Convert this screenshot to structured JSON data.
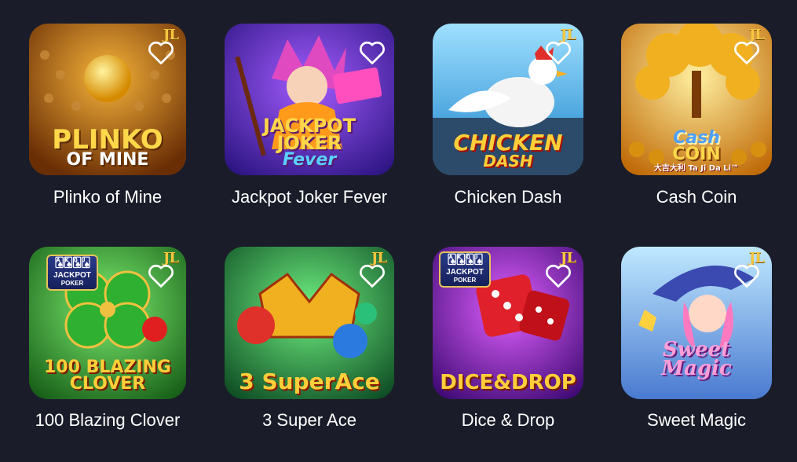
{
  "games": [
    {
      "title": "Plinko of Mine",
      "logo_lines": [
        "PLINKO",
        "OF MINE"
      ],
      "provider": "JL",
      "favorite_icon": "heart-outline-icon",
      "colors": {
        "bg1": "#f0a020",
        "bg2": "#7a3b08",
        "logo": "#ffd84a"
      }
    },
    {
      "title": "Jackpot Joker Fever",
      "logo_lines": [
        "JACKPOT JOKER",
        "Fever"
      ],
      "provider": "",
      "favorite_icon": "heart-outline-icon",
      "colors": {
        "bg1": "#7a3cf0",
        "bg2": "#2a1a8a",
        "logo": "#ffd84a"
      }
    },
    {
      "title": "Chicken Dash",
      "logo_lines": [
        "CHICKEN",
        "DASH"
      ],
      "provider": "JL",
      "favorite_icon": "heart-outline-icon",
      "colors": {
        "bg1": "#6fc8f0",
        "bg2": "#2b6fa0",
        "logo": "#ffcf3a"
      }
    },
    {
      "title": "Cash Coin",
      "logo_lines": [
        "Cash",
        "COIN",
        "大吉大利 Ta Ji Da Li™"
      ],
      "provider": "JL",
      "favorite_icon": "heart-outline-icon",
      "colors": {
        "bg1": "#ffd76a",
        "bg2": "#c77a10",
        "logo": "#3a8fe0"
      }
    },
    {
      "title": "100 Blazing Clover",
      "logo_lines": [
        "100 BLAZING",
        "CLOVER"
      ],
      "provider": "JL",
      "badge": {
        "top": "JACKPOT",
        "bottom": "POKER"
      },
      "favorite_icon": "heart-outline-icon",
      "colors": {
        "bg1": "#4fd04a",
        "bg2": "#1b6a1a",
        "logo": "#ffcf3a"
      }
    },
    {
      "title": "3 Super Ace",
      "logo_lines": [
        "3 SuperAce"
      ],
      "provider": "JL",
      "favorite_icon": "heart-outline-icon",
      "colors": {
        "bg1": "#3cc25a",
        "bg2": "#0f5a2a",
        "logo": "#ffcf3a"
      }
    },
    {
      "title": "Dice & Drop",
      "logo_lines": [
        "DICE&DROP"
      ],
      "provider": "JL",
      "badge": {
        "top": "JACKPOT",
        "bottom": "POKER"
      },
      "favorite_icon": "heart-outline-icon",
      "colors": {
        "bg1": "#c23ae0",
        "bg2": "#4a0f7a",
        "logo": "#ffcf3a"
      }
    },
    {
      "title": "Sweet Magic",
      "logo_lines": [
        "Sweet Magic"
      ],
      "provider": "JL",
      "favorite_icon": "heart-outline-icon",
      "colors": {
        "bg1": "#7fd0f0",
        "bg2": "#3a6fc0",
        "logo": "#ff9ed8"
      }
    }
  ]
}
